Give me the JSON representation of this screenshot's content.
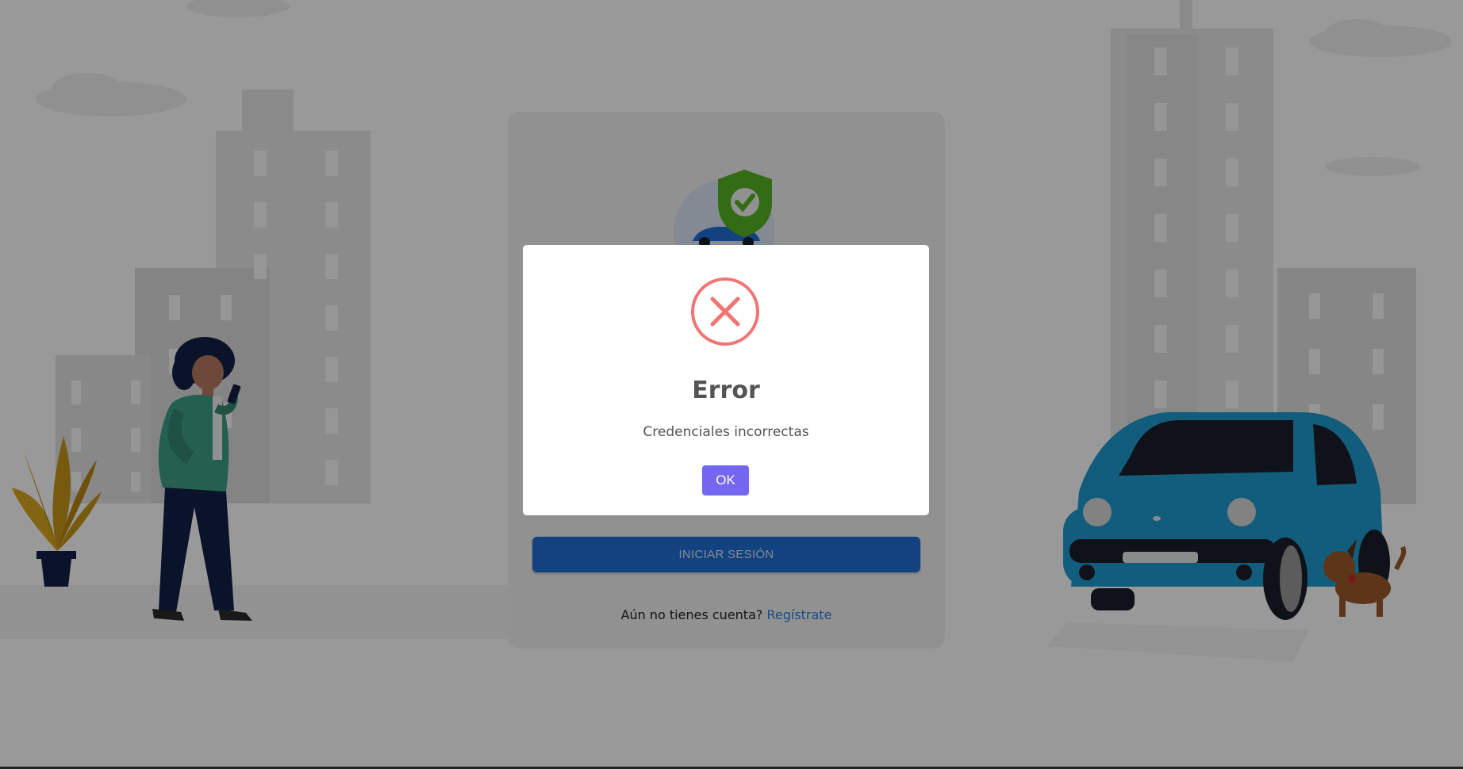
{
  "colors": {
    "overlay": "rgba(0,0,0,0.4)",
    "primary_button": "#1f6fd6",
    "ok_button": "#7367f0",
    "error_red": "#f27474",
    "link": "#2b7de0"
  },
  "login": {
    "logo_icon": "shield-check-car-icon",
    "submit_label": "INICIAR SESIÓN",
    "register_prompt": "Aún no tienes cuenta?",
    "register_link": "Regístrate"
  },
  "dialog": {
    "icon": "error-x-icon",
    "title": "Error",
    "message": "Credenciales incorrectas",
    "ok_label": "OK"
  }
}
